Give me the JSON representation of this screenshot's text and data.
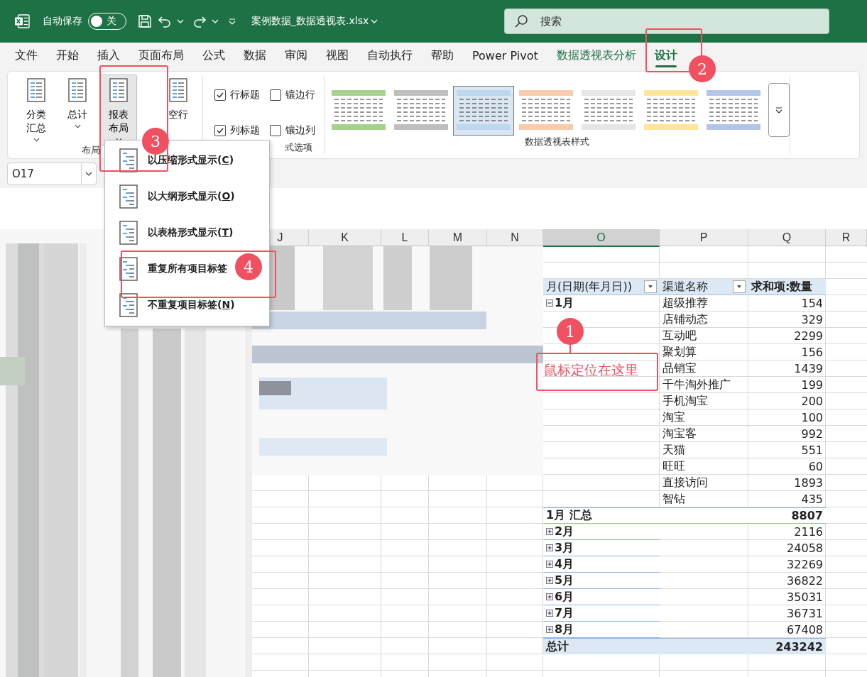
{
  "title_bar": {
    "autosave_label": "自动保存",
    "autosave_toggle": {
      "on": false,
      "label": "关"
    },
    "file_name": "案例数据_数据透视表.xlsx",
    "search_placeholder": "搜索"
  },
  "menu_tabs": [
    {
      "label": "文件",
      "selected": false,
      "kind": "normal"
    },
    {
      "label": "开始",
      "selected": false,
      "kind": "normal"
    },
    {
      "label": "插入",
      "selected": false,
      "kind": "normal"
    },
    {
      "label": "页面布局",
      "selected": false,
      "kind": "normal"
    },
    {
      "label": "公式",
      "selected": false,
      "kind": "normal"
    },
    {
      "label": "数据",
      "selected": false,
      "kind": "normal"
    },
    {
      "label": "审阅",
      "selected": false,
      "kind": "normal"
    },
    {
      "label": "视图",
      "selected": false,
      "kind": "normal"
    },
    {
      "label": "自动执行",
      "selected": false,
      "kind": "normal"
    },
    {
      "label": "帮助",
      "selected": false,
      "kind": "normal"
    },
    {
      "label": "Power Pivot",
      "selected": false,
      "kind": "normal"
    },
    {
      "label": "数据透视表分析",
      "selected": false,
      "kind": "context"
    },
    {
      "label": "设计",
      "selected": true,
      "kind": "context"
    }
  ],
  "ribbon": {
    "layout_group": {
      "title": "布局",
      "buttons": [
        {
          "label": "分类汇总",
          "dropdown": true,
          "pressed": false
        },
        {
          "label": "总计",
          "dropdown": true,
          "pressed": false
        },
        {
          "label": "报表布局",
          "dropdown": true,
          "pressed": true
        },
        {
          "label": "空行",
          "dropdown": false,
          "pressed": false
        }
      ]
    },
    "options_group": {
      "title": "式选项",
      "checkboxes": [
        {
          "label": "行标题",
          "checked": true
        },
        {
          "label": "镶边行",
          "checked": false
        },
        {
          "label": "列标题",
          "checked": true
        },
        {
          "label": "镶边列",
          "checked": false
        }
      ]
    },
    "styles_group": {
      "title": "数据透视表样式",
      "swatches": [
        {
          "color": "#a9d08e",
          "selected": false
        },
        {
          "color": "#bfbfbf",
          "selected": false
        },
        {
          "color": "#bdd7ee",
          "selected": true
        },
        {
          "color": "#f8cbad",
          "selected": false
        },
        {
          "color": "#e7e6e6",
          "selected": false
        },
        {
          "color": "#ffe699",
          "selected": false
        },
        {
          "color": "#b4c6e7",
          "selected": false
        }
      ]
    }
  },
  "name_box": "O17",
  "layout_menu": [
    {
      "text": "以压缩形式显示(",
      "hotkey": "C",
      "after": ")"
    },
    {
      "text": "以大纲形式显示(",
      "hotkey": "O",
      "after": ")"
    },
    {
      "text": "以表格形式显示(",
      "hotkey": "T",
      "after": ")"
    },
    {
      "text": "重复所有项目标签"
    },
    {
      "text": "不重复项目标签(",
      "hotkey": "N",
      "after": ")"
    }
  ],
  "sheet": {
    "columns": [
      {
        "label": "J",
        "selected": false
      },
      {
        "label": "K",
        "selected": false
      },
      {
        "label": "L",
        "selected": false
      },
      {
        "label": "M",
        "selected": false
      },
      {
        "label": "N",
        "selected": false
      },
      {
        "label": "O",
        "selected": true
      },
      {
        "label": "P",
        "selected": false
      },
      {
        "label": "Q",
        "selected": false
      },
      {
        "label": "R",
        "selected": false
      }
    ],
    "pivot": {
      "row_field": "月(日期(年月日))",
      "column_field": "渠道名称",
      "value_field": "求和项:数量",
      "groups": [
        {
          "month": "1月",
          "expanded": true,
          "items": [
            {
              "channel": "超级推荐",
              "value": "154"
            },
            {
              "channel": "店铺动态",
              "value": "329"
            },
            {
              "channel": "互动吧",
              "value": "2299"
            },
            {
              "channel": "聚划算",
              "value": "156"
            },
            {
              "channel": "品销宝",
              "value": "1439"
            },
            {
              "channel": "千牛淘外推广",
              "value": "199"
            },
            {
              "channel": "手机淘宝",
              "value": "200"
            },
            {
              "channel": "淘宝",
              "value": "100"
            },
            {
              "channel": "淘宝客",
              "value": "992"
            },
            {
              "channel": "天猫",
              "value": "551"
            },
            {
              "channel": "旺旺",
              "value": "60"
            },
            {
              "channel": "直接访问",
              "value": "1893"
            },
            {
              "channel": "智钻",
              "value": "435"
            }
          ],
          "subtotal_label": "1月 汇总",
          "subtotal": "8807"
        },
        {
          "month": "2月",
          "expanded": false,
          "total": "2116"
        },
        {
          "month": "3月",
          "expanded": false,
          "total": "24058"
        },
        {
          "month": "4月",
          "expanded": false,
          "total": "32269"
        },
        {
          "month": "5月",
          "expanded": false,
          "total": "36822"
        },
        {
          "month": "6月",
          "expanded": false,
          "total": "35031"
        },
        {
          "month": "7月",
          "expanded": false,
          "total": "36731"
        },
        {
          "month": "8月",
          "expanded": false,
          "total": "67408"
        }
      ],
      "grand_total": {
        "label": "总计",
        "value": "243242"
      }
    }
  },
  "annotations": {
    "markers": [
      "1",
      "2",
      "3",
      "4"
    ],
    "note": "鼠标定位在这里"
  }
}
